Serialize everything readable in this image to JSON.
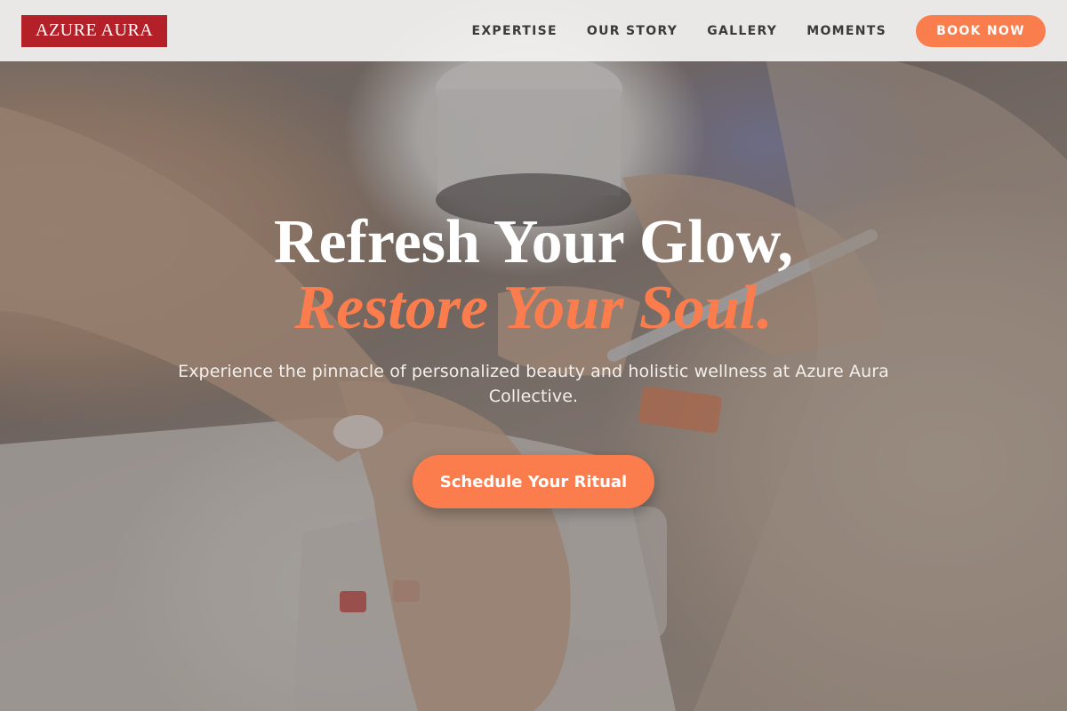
{
  "brand": {
    "logo_text": "AZURE AURA"
  },
  "nav": {
    "items": [
      {
        "label": "EXPERTISE"
      },
      {
        "label": "OUR STORY"
      },
      {
        "label": "GALLERY"
      },
      {
        "label": "MOMENTS"
      }
    ],
    "cta_label": "BOOK NOW"
  },
  "hero": {
    "headline_line1": "Refresh Your Glow,",
    "headline_line2": "Restore Your Soul.",
    "subtitle": "Experience the pinnacle of personalized beauty and holistic wellness at Azure Aura Collective.",
    "cta_label": "Schedule Your Ritual",
    "background_image": "nail-manicure-photo"
  },
  "colors": {
    "accent": "#fb7d4d",
    "logo_bg": "#b42027",
    "nav_text": "#3a3a3a",
    "header_bg": "#f3f2f1"
  }
}
